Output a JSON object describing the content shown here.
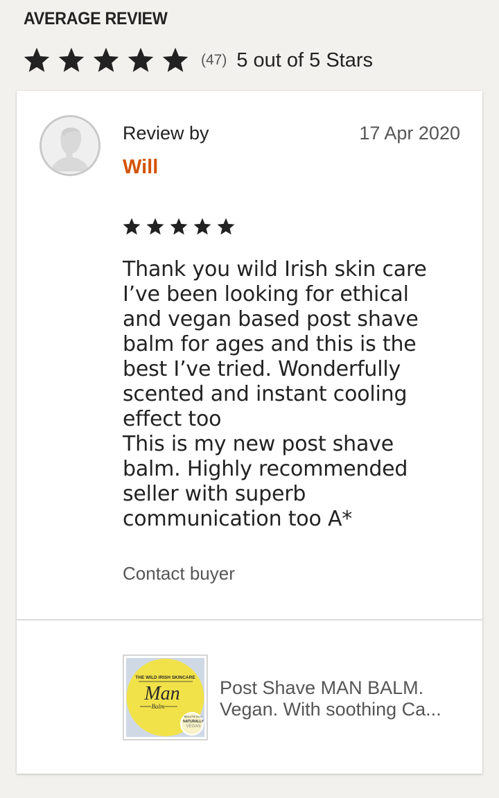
{
  "summary": {
    "title": "AVERAGE REVIEW",
    "stars_filled": 5,
    "stars_total": 5,
    "count": "(47)",
    "rating_text": "5 out of 5 Stars"
  },
  "review": {
    "by_label": "Review by",
    "date": "17 Apr 2020",
    "reviewer_name": "Will",
    "stars_filled": 5,
    "stars_total": 5,
    "text_lines": [
      "Thank you wild Irish skin care",
      "I’ve been looking for ethical",
      "and vegan based post shave",
      "balm for ages and this is the",
      "best I’ve tried. Wonderfully",
      "scented and instant cooling",
      "effect too",
      "This is my new post shave",
      "balm. Highly recommended",
      "seller with superb",
      "communication too A*"
    ],
    "contact_label": "Contact buyer"
  },
  "product": {
    "title_line1": "Post Shave MAN BALM.",
    "title_line2": "Vegan. With soothing Ca...",
    "thumb_brand": "THE WILD IRISH SKINCARE",
    "thumb_name": "Man",
    "thumb_sub": "Balm",
    "thumb_badge_1": "BEAUTIFULLY",
    "thumb_badge_2": "NATURALLY",
    "thumb_badge_3": "VEGAN"
  },
  "colors": {
    "accent_name": "#d35400",
    "star": "#222222",
    "thumb_yellow": "#f2e24a"
  },
  "icons": {
    "star": "star-icon",
    "avatar": "default-avatar-icon"
  }
}
